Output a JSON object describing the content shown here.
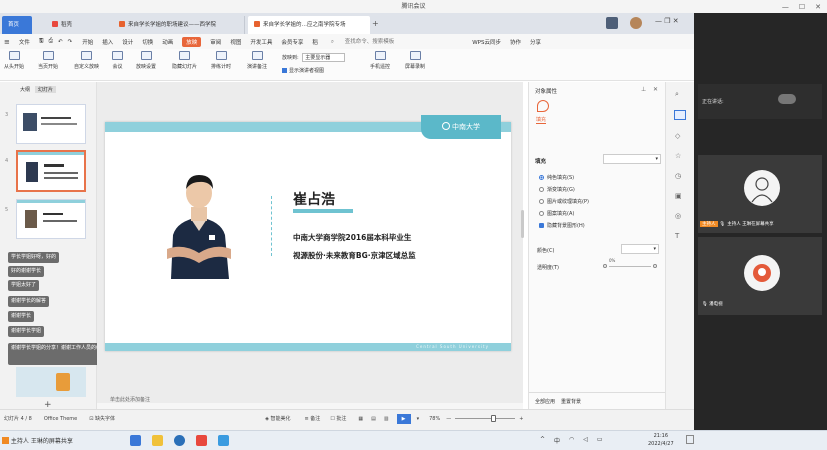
{
  "window": {
    "title": "腾讯会议"
  },
  "tabs": [
    {
      "label": "首页"
    },
    {
      "label": "稻壳"
    },
    {
      "label": "来自学长学姐的职场建议——西学院"
    },
    {
      "label": "来自学长学姐的…应之南学院专场"
    }
  ],
  "menu": {
    "file": "文件",
    "items": [
      "开始",
      "插入",
      "设计",
      "切换",
      "动画",
      "放映",
      "审阅",
      "视图",
      "开发工具",
      "会员专享",
      "稻"
    ],
    "active": "放映",
    "search_placeholder": "查找命令、搜索模板",
    "right": [
      "WPS云同步",
      "协作",
      "分享"
    ]
  },
  "ribbon": {
    "buttons": [
      "从头开始",
      "当页开始",
      "自定义放映",
      "会议",
      "放映设置",
      "隐藏幻灯片",
      "排练计时",
      "演讲备注"
    ],
    "monitor_label": "放映到:",
    "monitor_value": "主要显示器",
    "presenter_view": "显示演讲者视图",
    "phone_remote": "手机遥控",
    "screen_record": "屏幕录制"
  },
  "left_panel": {
    "tabs": [
      "大纲",
      "幻灯片"
    ],
    "slide_numbers": [
      "3",
      "4",
      "5"
    ],
    "add_slide": "+"
  },
  "chat_messages": [
    {
      "name": "",
      "text": "学长学姐好呀，好的"
    },
    {
      "name": "",
      "text": "好的谢谢学长"
    },
    {
      "name": "",
      "text": "学姐太好了"
    },
    {
      "name": "",
      "text": "谢谢学长的解答"
    },
    {
      "name": "",
      "text": "谢谢学长"
    },
    {
      "name": "",
      "text": "谢谢学长学姐"
    },
    {
      "name": "",
      "text": "谢谢学长学姐的分享！谢谢工作人员的组织！"
    }
  ],
  "slide": {
    "logo_text": "中南大学",
    "name": "崔占浩",
    "line1": "中南大学商学院2016届本科毕业生",
    "line2": "视源股份·未来教育BG·京津区域总监",
    "footer_text": "Central South University"
  },
  "notes_placeholder": "单击此处添加备注",
  "right_panel": {
    "title": "对象属性",
    "fill_tab": "填充",
    "fill_label": "填充",
    "options": [
      "纯色填充(S)",
      "渐变填充(G)",
      "图片或纹理填充(P)",
      "图案填充(A)",
      "隐藏背景图形(H)"
    ],
    "color_label": "颜色(C)",
    "transparency_label": "透明度(T)",
    "transparency_value": "0%",
    "apply_all": "全部应用",
    "reset_bg": "重置背景"
  },
  "statusbar": {
    "slide_info": "幻灯片 4 / 8",
    "theme": "Office Theme",
    "missing_font": "缺失字体",
    "smart_beautify": "智能美化",
    "notes": "备注",
    "comments": "批注",
    "zoom": "78%"
  },
  "video": {
    "speaking_label": "正在讲话:",
    "host_label": "主持人",
    "host_detail": "主持人 王琳在屏幕共享",
    "participant2": "潘电视"
  },
  "taskbar": {
    "sharing_text": "主持人 王琳的屏幕共享",
    "lang": "中",
    "time": "21:16",
    "date": "2022/4/27"
  }
}
